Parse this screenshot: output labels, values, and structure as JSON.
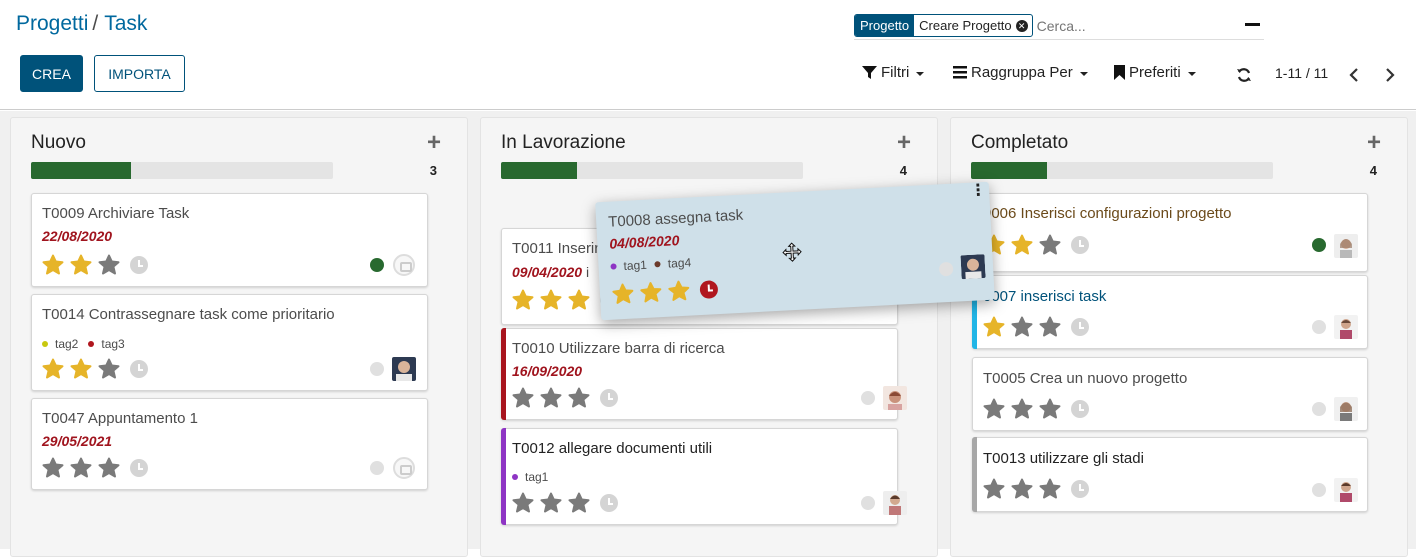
{
  "breadcrumb": {
    "parent": "Progetti",
    "separator": "/",
    "current": "Task"
  },
  "actions": {
    "create": "CREA",
    "import": "IMPORTA"
  },
  "search": {
    "facet_label": "Progetto",
    "facet_value": "Creare Progetto",
    "placeholder": "Cerca..."
  },
  "toolbar": {
    "filters": "Filtri",
    "groupby": "Raggruppa Per",
    "favorites": "Preferiti"
  },
  "pager": {
    "value": "1-11 / 11"
  },
  "colors": {
    "brand": "#00527a",
    "progress": "#28692f",
    "deadline": "#a0141e",
    "star_on": "#e6b429",
    "star_off": "#7a7a7a"
  },
  "columns": [
    {
      "title": "Nuovo",
      "count": "3",
      "progress": 0.33
    },
    {
      "title": "In Lavorazione",
      "count": "4",
      "progress": 0.25
    },
    {
      "title": "Completato",
      "count": "4",
      "progress": 0.25
    }
  ],
  "cards": {
    "t0009": {
      "name": "T0009 Archiviare Task",
      "date": "22/08/2020",
      "stars": 2
    },
    "t0014": {
      "name": "T0014 Contrassegnare task come prioritario",
      "tags": [
        "tag2",
        "tag3"
      ],
      "stars": 2
    },
    "t0047": {
      "name": "T0047 Appuntamento 1",
      "date": "29/05/2021",
      "stars": 0
    },
    "t0011": {
      "name": "T0011 Inserir",
      "date": "09/04/2020",
      "date_suffix": "i",
      "stars": 3
    },
    "t0010": {
      "name": "T0010 Utilizzare barra di ricerca",
      "date": "16/09/2020",
      "stars": 0
    },
    "t0012": {
      "name": "T0012 allegare documenti utili",
      "tags": [
        "tag1"
      ],
      "stars": 0
    },
    "t0006": {
      "name": "0006 Inserisci configurazioni progetto",
      "stars": 2
    },
    "t0007": {
      "name": "0007 inserisci task",
      "stars": 1
    },
    "t0005": {
      "name": "T0005 Crea un nuovo progetto",
      "stars": 0
    },
    "t0013": {
      "name": "T0013 utilizzare gli stadi",
      "stars": 0
    },
    "t0008": {
      "name": "T0008 assegna task",
      "date": "04/08/2020",
      "tags": [
        "tag1",
        "tag4"
      ],
      "stars": 3
    }
  }
}
